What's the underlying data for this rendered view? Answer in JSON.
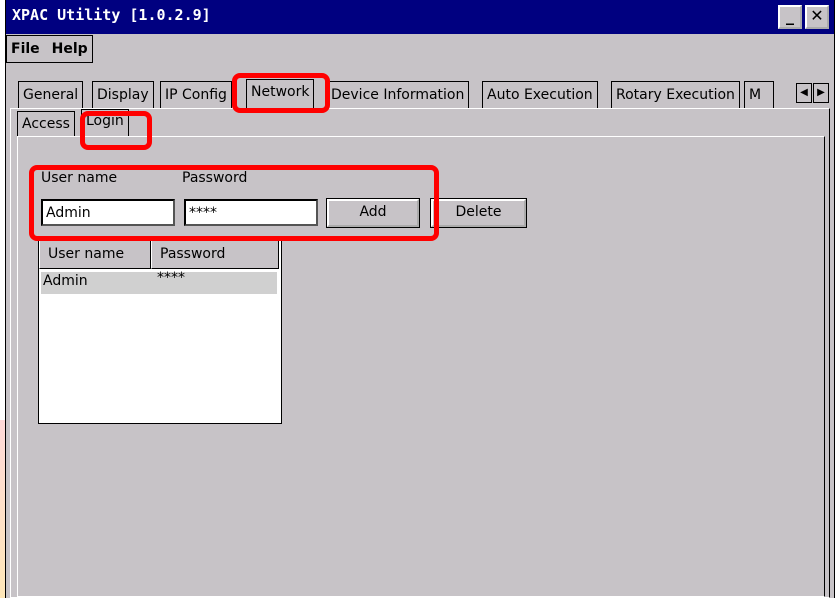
{
  "window": {
    "title": "XPAC Utility  [1.0.2.9]",
    "minimize_glyph": "_",
    "close_glyph": "✕"
  },
  "menu": {
    "items": [
      {
        "label": "File"
      },
      {
        "label": "Help"
      }
    ]
  },
  "tabs": [
    {
      "label": "General"
    },
    {
      "label": "Display"
    },
    {
      "label": "IP Config"
    },
    {
      "label": "Network",
      "active": true
    },
    {
      "label": "Device Information"
    },
    {
      "label": "Auto Execution"
    },
    {
      "label": "Rotary Execution"
    },
    {
      "label": "M"
    }
  ],
  "tab_scroll": {
    "left_glyph": "◀",
    "right_glyph": "▶"
  },
  "subtabs": [
    {
      "label": "Access"
    },
    {
      "label": "Login",
      "active": true
    }
  ],
  "login": {
    "username_label": "User name",
    "password_label": "Password",
    "username_value": "Admin",
    "password_value": "****",
    "add_label": "Add",
    "delete_label": "Delete"
  },
  "user_list": {
    "columns": [
      "User name",
      "Password"
    ],
    "rows": [
      {
        "user": "Admin",
        "password": "****"
      }
    ]
  },
  "colors": {
    "titlebar": "#000080",
    "window_bg": "#c7c3c7",
    "highlight": "#ff0000"
  }
}
